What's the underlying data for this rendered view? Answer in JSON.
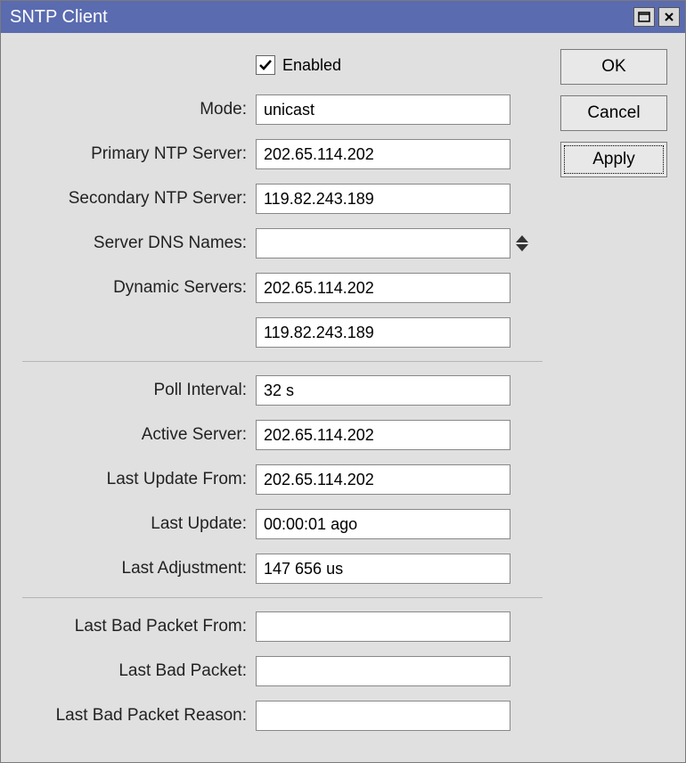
{
  "window": {
    "title": "SNTP Client"
  },
  "buttons": {
    "ok": "OK",
    "cancel": "Cancel",
    "apply": "Apply"
  },
  "labels": {
    "enabled": "Enabled",
    "mode": "Mode:",
    "primary_ntp": "Primary NTP Server:",
    "secondary_ntp": "Secondary NTP Server:",
    "server_dns": "Server DNS Names:",
    "dynamic_servers": "Dynamic Servers:",
    "poll_interval": "Poll Interval:",
    "active_server": "Active Server:",
    "last_update_from": "Last Update From:",
    "last_update": "Last Update:",
    "last_adjustment": "Last Adjustment:",
    "last_bad_packet_from": "Last Bad Packet From:",
    "last_bad_packet": "Last Bad Packet:",
    "last_bad_packet_reason": "Last Bad Packet Reason:"
  },
  "values": {
    "enabled_checked": true,
    "mode": "unicast",
    "primary_ntp": "202.65.114.202",
    "secondary_ntp": "119.82.243.189",
    "server_dns": "",
    "dynamic_servers": [
      "202.65.114.202",
      "119.82.243.189"
    ],
    "poll_interval": "32 s",
    "active_server": "202.65.114.202",
    "last_update_from": "202.65.114.202",
    "last_update": "00:00:01 ago",
    "last_adjustment": "147 656 us",
    "last_bad_packet_from": "",
    "last_bad_packet": "",
    "last_bad_packet_reason": ""
  }
}
